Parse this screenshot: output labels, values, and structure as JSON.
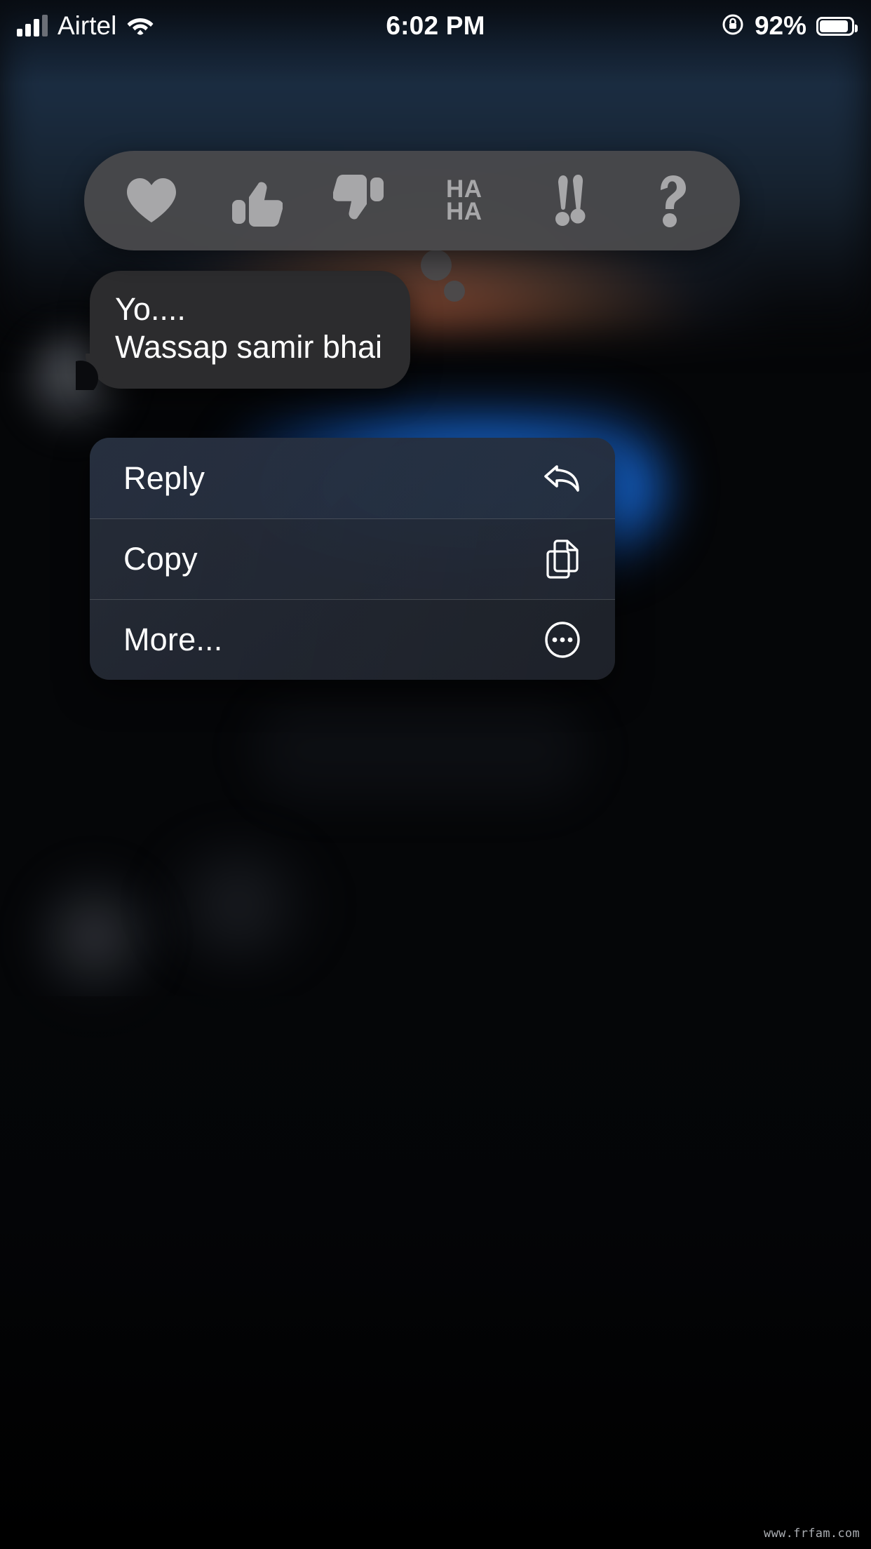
{
  "status_bar": {
    "carrier": "Airtel",
    "time": "6:02 PM",
    "battery_percent": "92%",
    "signal_icon": "cellular-signal-icon",
    "wifi_icon": "wifi-icon",
    "rotation_lock_icon": "rotation-lock-icon",
    "battery_icon": "battery-icon"
  },
  "reaction_bar": {
    "reactions": [
      {
        "name": "heart-reaction",
        "icon": "heart-icon",
        "label": "Love"
      },
      {
        "name": "thumbs-up-reaction",
        "icon": "thumbs-up-icon",
        "label": "Like"
      },
      {
        "name": "thumbs-down-reaction",
        "icon": "thumbs-down-icon",
        "label": "Dislike"
      },
      {
        "name": "haha-reaction",
        "icon": "haha-icon",
        "label": "HA HA",
        "line1": "HA",
        "line2": "HA"
      },
      {
        "name": "exclamation-reaction",
        "icon": "double-exclamation-icon",
        "label": "!!"
      },
      {
        "name": "question-reaction",
        "icon": "question-mark-icon",
        "label": "?"
      }
    ],
    "background_color": "#4a4a4c",
    "icon_color": "#a7a7a9"
  },
  "message": {
    "line1": "Yo....",
    "line2": "Wassap samir bhai",
    "bubble_color": "#2c2c2e",
    "text_color": "#ffffff",
    "sender": "incoming"
  },
  "context_menu": {
    "items": [
      {
        "label": "Reply",
        "icon": "reply-arrow-icon"
      },
      {
        "label": "Copy",
        "icon": "copy-document-icon"
      },
      {
        "label": "More...",
        "icon": "ellipsis-circle-icon"
      }
    ]
  },
  "background": {
    "blue_bubble_color": "#1f7ff0",
    "accent_glow_color": "#e8784e"
  },
  "watermark": {
    "text": "www.frfam.com"
  }
}
